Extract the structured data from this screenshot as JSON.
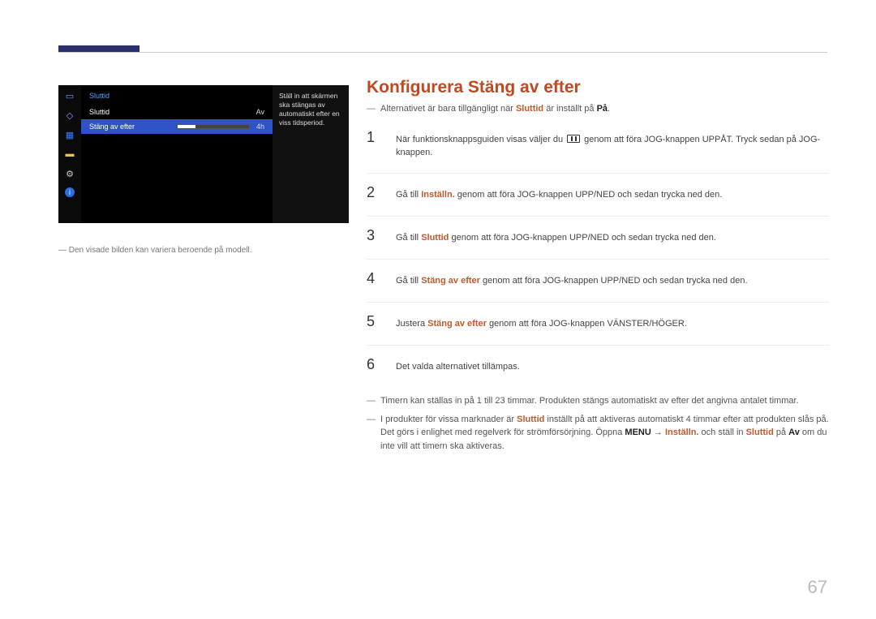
{
  "header": {},
  "osd": {
    "title": "Sluttid",
    "row1": {
      "label": "Sluttid",
      "value": "Av"
    },
    "row2": {
      "label": "Stäng av efter",
      "value": "4h"
    },
    "desc": "Ställ in att skärmen ska stängas av automatiskt efter en viss tidsperiod."
  },
  "imgNote": "― Den visade bilden kan variera beroende på modell.",
  "page": {
    "title": "Konfigurera Stäng av efter",
    "topNote": {
      "pre": "Alternativet är bara tillgängligt när ",
      "hl": "Sluttid",
      "post": " är inställt på ",
      "bold": "På",
      "end": "."
    },
    "steps": [
      {
        "n": "1",
        "pre": "När funktionsknappsguiden visas väljer du ",
        "post": " genom att föra JOG-knappen UPPÅT. Tryck sedan på JOG-knappen.",
        "icon": true
      },
      {
        "n": "2",
        "pre": "Gå till ",
        "hl": "Inställn.",
        "post": " genom att föra JOG-knappen UPP/NED och sedan trycka ned den."
      },
      {
        "n": "3",
        "pre": "Gå till ",
        "hl": "Sluttid",
        "post": " genom att föra JOG-knappen UPP/NED och sedan trycka ned den."
      },
      {
        "n": "4",
        "pre": "Gå till ",
        "hl": "Stäng av efter",
        "post": " genom att föra JOG-knappen UPP/NED och sedan trycka ned den."
      },
      {
        "n": "5",
        "pre": "Justera ",
        "hl": "Stäng av efter",
        "post": " genom att föra JOG-knappen VÄNSTER/HÖGER."
      },
      {
        "n": "6",
        "pre": "Det valda alternativet tillämpas."
      }
    ],
    "note1": "Timern kan ställas in på 1 till 23 timmar. Produkten stängs automatiskt av efter det angivna antalet timmar.",
    "note2": {
      "t1": "I produkter för vissa marknader är ",
      "hl1": "Sluttid",
      "t2": " inställt på att aktiveras automatiskt 4 timmar efter att produkten slås på. Det görs i enlighet med regelverk för strömförsörjning. Öppna ",
      "b1": "MENU",
      "arrow": " → ",
      "hl2": "Inställn.",
      "t3": " och ställ in ",
      "hl3": "Sluttid",
      "t4": " på ",
      "b2": "Av",
      "t5": " om du inte vill att timern ska aktiveras."
    }
  },
  "pageNumber": "67"
}
